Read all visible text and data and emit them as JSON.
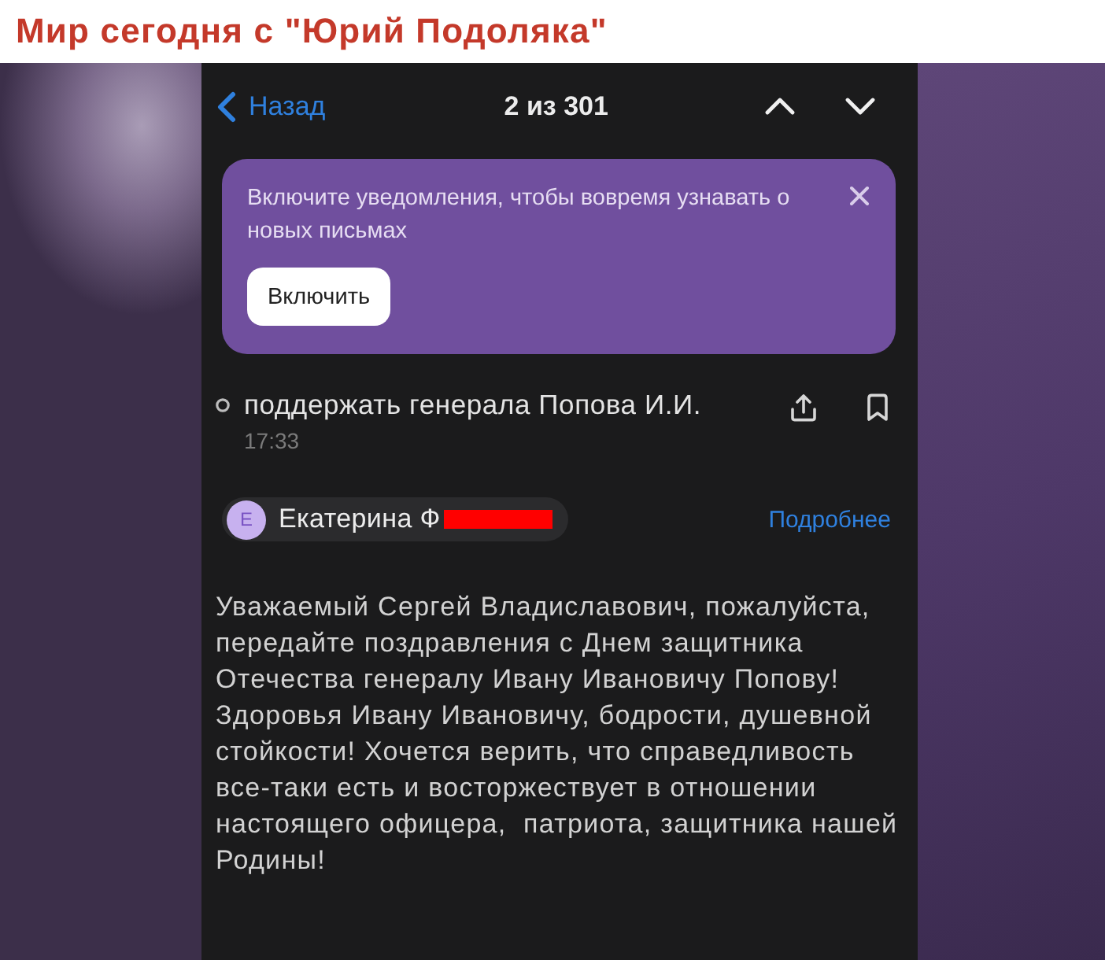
{
  "header": {
    "title": "Мир сегодня с \"Юрий Подоляка\""
  },
  "nav": {
    "back": "Назад",
    "counter": "2 из 301"
  },
  "notification": {
    "text": "Включите уведомления, чтобы вовремя узнавать о новых письмах",
    "button": "Включить"
  },
  "message": {
    "unread": false,
    "subject": "поддержать генерала Попова И.И.",
    "time": "17:33",
    "sender": {
      "initial": "Е",
      "name": "Екатерина Ф",
      "redacted": true
    },
    "details_link": "Подробнее",
    "body": "Уважаемый Сергей Владиславович, пожалуйста, передайте поздравления с Днем защитника Отечества генералу Ивану Ивановичу Попову! Здоровья Ивану Ивановичу, бодрости, душевной стойкости! Хочется верить, что справедливость все-таки есть и восторжествует в отношении настоящего офицера,  патриота, защитника нашей Родины!"
  }
}
